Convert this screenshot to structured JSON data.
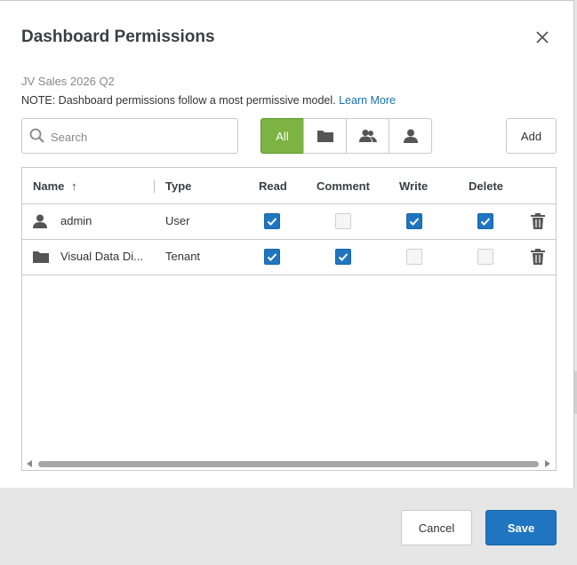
{
  "dialog": {
    "title": "Dashboard Permissions",
    "subtitle": "JV Sales 2026 Q2",
    "note": "NOTE: Dashboard permissions follow a most permissive model.",
    "learn_more": "Learn More"
  },
  "search": {
    "placeholder": "Search",
    "value": ""
  },
  "filters": {
    "all_label": "All",
    "active": "All"
  },
  "add_label": "Add",
  "table": {
    "headers": {
      "name": "Name",
      "sort_indicator": "↑",
      "type": "Type",
      "read": "Read",
      "comment": "Comment",
      "write": "Write",
      "delete": "Delete"
    },
    "rows": [
      {
        "icon": "user-icon",
        "name": "admin",
        "type": "User",
        "read": true,
        "comment": false,
        "write": true,
        "delete": true
      },
      {
        "icon": "folder-icon",
        "name": "Visual Data Di...",
        "type": "Tenant",
        "read": true,
        "comment": true,
        "write": false,
        "delete": false
      }
    ]
  },
  "footer": {
    "cancel_label": "Cancel",
    "save_label": "Save"
  },
  "colors": {
    "accent": "#1f75bf",
    "filter_active": "#7cb342",
    "link": "#1a6fb5"
  }
}
